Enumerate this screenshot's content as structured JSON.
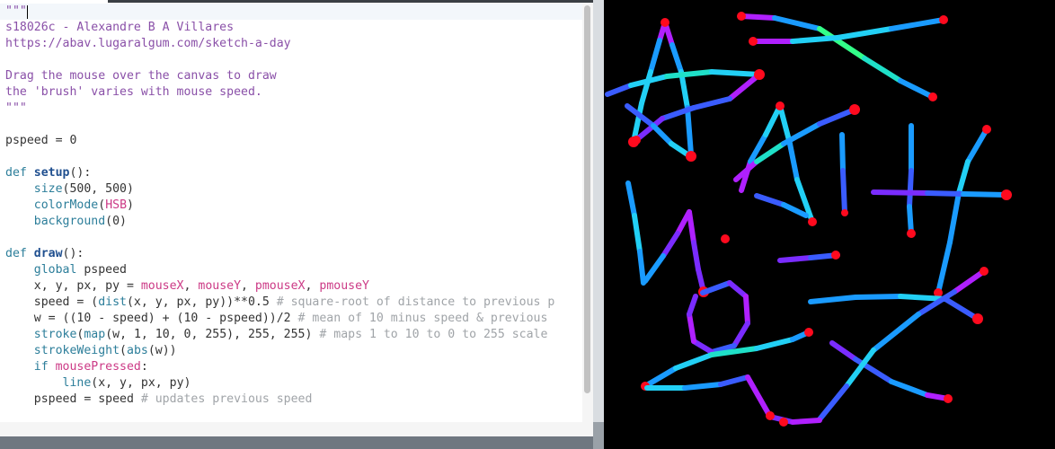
{
  "editor": {
    "lines": [
      [
        {
          "t": "\"\"\"",
          "c": "string"
        }
      ],
      [
        {
          "t": "s18026c - Alexandre B A Villares",
          "c": "string"
        }
      ],
      [
        {
          "t": "https://abav.lugaralgum.com/sketch-a-day",
          "c": "string"
        }
      ],
      [],
      [
        {
          "t": "Drag the mouse over the canvas to draw",
          "c": "string"
        }
      ],
      [
        {
          "t": "the 'brush' varies with mouse speed.",
          "c": "string"
        }
      ],
      [
        {
          "t": "\"\"\"",
          "c": "string"
        }
      ],
      [],
      [
        {
          "t": "pspeed = 0",
          "c": "default"
        }
      ],
      [],
      [
        {
          "t": "def ",
          "c": "keyword"
        },
        {
          "t": "setup",
          "c": "func"
        },
        {
          "t": "():",
          "c": "default"
        }
      ],
      [
        {
          "t": "    ",
          "c": "default"
        },
        {
          "t": "size",
          "c": "builtin"
        },
        {
          "t": "(500, 500)",
          "c": "default"
        }
      ],
      [
        {
          "t": "    ",
          "c": "default"
        },
        {
          "t": "colorMode",
          "c": "builtin"
        },
        {
          "t": "(",
          "c": "default"
        },
        {
          "t": "HSB",
          "c": "pink"
        },
        {
          "t": ")",
          "c": "default"
        }
      ],
      [
        {
          "t": "    ",
          "c": "default"
        },
        {
          "t": "background",
          "c": "builtin"
        },
        {
          "t": "(0)",
          "c": "default"
        }
      ],
      [],
      [
        {
          "t": "def ",
          "c": "keyword"
        },
        {
          "t": "draw",
          "c": "func"
        },
        {
          "t": "():",
          "c": "default"
        }
      ],
      [
        {
          "t": "    ",
          "c": "default"
        },
        {
          "t": "global ",
          "c": "keyword"
        },
        {
          "t": "pspeed",
          "c": "default"
        }
      ],
      [
        {
          "t": "    x, y, px, py = ",
          "c": "default"
        },
        {
          "t": "mouseX",
          "c": "pink"
        },
        {
          "t": ", ",
          "c": "default"
        },
        {
          "t": "mouseY",
          "c": "pink"
        },
        {
          "t": ", ",
          "c": "default"
        },
        {
          "t": "pmouseX",
          "c": "pink"
        },
        {
          "t": ", ",
          "c": "default"
        },
        {
          "t": "pmouseY",
          "c": "pink"
        }
      ],
      [
        {
          "t": "    speed = (",
          "c": "default"
        },
        {
          "t": "dist",
          "c": "builtin"
        },
        {
          "t": "(x, y, px, py))**0.5 ",
          "c": "default"
        },
        {
          "t": "# square-root of distance to previous p",
          "c": "comment"
        }
      ],
      [
        {
          "t": "    w = ((10 - speed) + (10 - pspeed))/2 ",
          "c": "default"
        },
        {
          "t": "# mean of 10 minus speed & previous",
          "c": "comment"
        }
      ],
      [
        {
          "t": "    ",
          "c": "default"
        },
        {
          "t": "stroke",
          "c": "builtin"
        },
        {
          "t": "(",
          "c": "default"
        },
        {
          "t": "map",
          "c": "builtin"
        },
        {
          "t": "(w, 1, 10, 0, 255), 255, 255) ",
          "c": "default"
        },
        {
          "t": "# maps 1 to 10 to 0 to 255 scale",
          "c": "comment"
        }
      ],
      [
        {
          "t": "    ",
          "c": "default"
        },
        {
          "t": "strokeWeight",
          "c": "builtin"
        },
        {
          "t": "(",
          "c": "default"
        },
        {
          "t": "abs",
          "c": "builtin"
        },
        {
          "t": "(w))",
          "c": "default"
        }
      ],
      [
        {
          "t": "    ",
          "c": "default"
        },
        {
          "t": "if ",
          "c": "keyword"
        },
        {
          "t": "mousePressed",
          "c": "pink"
        },
        {
          "t": ":",
          "c": "default"
        }
      ],
      [
        {
          "t": "        ",
          "c": "default"
        },
        {
          "t": "line",
          "c": "builtin"
        },
        {
          "t": "(x, y, px, py)",
          "c": "default"
        }
      ],
      [
        {
          "t": "    pspeed = speed ",
          "c": "default"
        },
        {
          "t": "# updates previous speed",
          "c": "comment"
        }
      ]
    ]
  },
  "canvas": {
    "background": "#000000",
    "colors": {
      "red": "#ff0a1e",
      "magenta": "#b020ff",
      "purple": "#7a2cff",
      "blue": "#3a5cff",
      "sky": "#1a9bff",
      "cyan": "#22d0f5",
      "teal": "#1fe0c8",
      "green": "#33ff88"
    }
  }
}
